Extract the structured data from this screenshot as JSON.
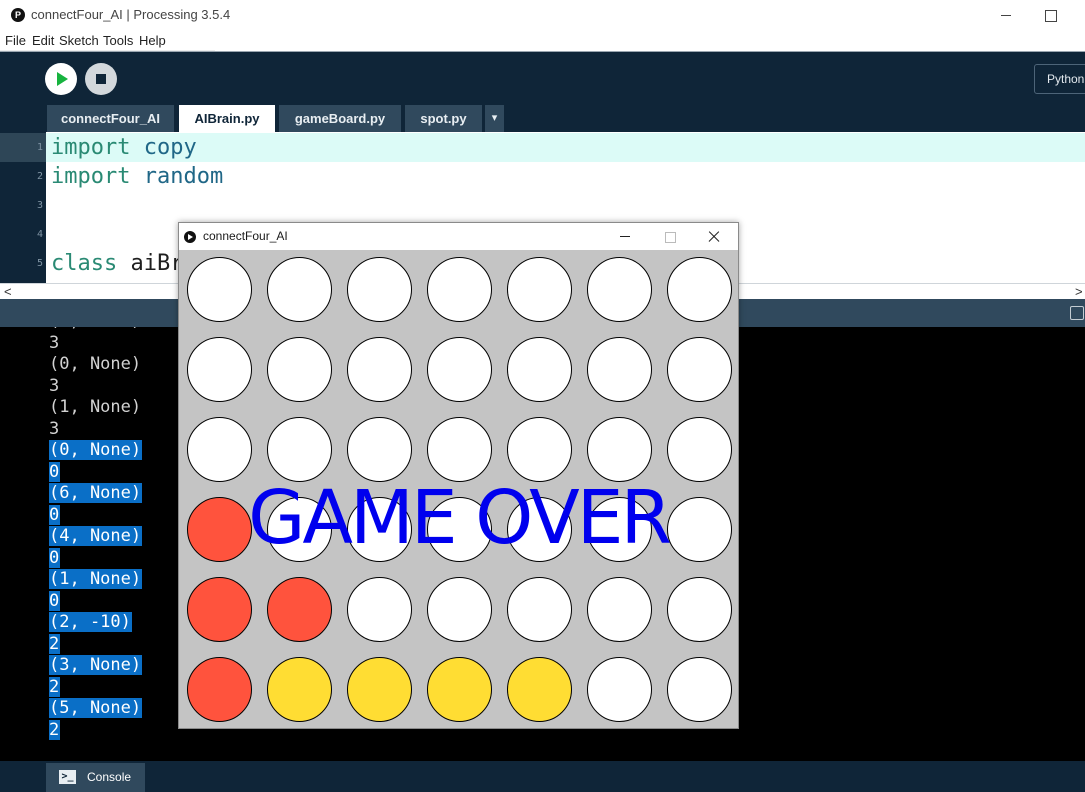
{
  "window": {
    "title": "connectFour_AI | Processing 3.5.4",
    "icon": "processing-logo-icon"
  },
  "menu": [
    "File",
    "Edit",
    "Sketch",
    "Tools",
    "Help"
  ],
  "toolbar": {
    "run_icon": "run-icon",
    "stop_icon": "stop-icon",
    "mode_label": "Python"
  },
  "tabs": [
    {
      "label": "connectFour_AI",
      "active": false
    },
    {
      "label": "AIBrain.py",
      "active": true
    },
    {
      "label": "gameBoard.py",
      "active": false
    },
    {
      "label": "spot.py",
      "active": false
    }
  ],
  "tab_menu_glyph": "▾",
  "editor": {
    "current_line": 1,
    "lines": [
      {
        "number": "1",
        "tokens": [
          {
            "text": "import",
            "kind": "kw"
          },
          {
            "text": " ",
            "kind": "plain"
          },
          {
            "text": "copy",
            "kind": "id"
          }
        ]
      },
      {
        "number": "2",
        "tokens": [
          {
            "text": "import",
            "kind": "kw"
          },
          {
            "text": " ",
            "kind": "plain"
          },
          {
            "text": "random",
            "kind": "id"
          }
        ]
      },
      {
        "number": "3",
        "tokens": []
      },
      {
        "number": "4",
        "tokens": []
      },
      {
        "number": "5",
        "tokens": [
          {
            "text": "class",
            "kind": "kw"
          },
          {
            "text": " ",
            "kind": "plain"
          },
          {
            "text": "aiBrain",
            "kind": "plain"
          }
        ]
      }
    ]
  },
  "scrollbar": {
    "left_arrow": "<",
    "right_arrow": ">"
  },
  "console": {
    "lines": [
      {
        "text": "(?, None)",
        "selected": false
      },
      {
        "text": "3",
        "selected": false
      },
      {
        "text": "(0, None)",
        "selected": false
      },
      {
        "text": "3",
        "selected": false
      },
      {
        "text": "(1, None)",
        "selected": false
      },
      {
        "text": "3",
        "selected": false
      },
      {
        "text": "(0, None)",
        "selected": true
      },
      {
        "text": "0",
        "selected": true
      },
      {
        "text": "(6, None)",
        "selected": true
      },
      {
        "text": "0",
        "selected": true
      },
      {
        "text": "(4, None)",
        "selected": true
      },
      {
        "text": "0",
        "selected": true
      },
      {
        "text": "(1, None)",
        "selected": true
      },
      {
        "text": "0",
        "selected": true
      },
      {
        "text": "(2, -10)",
        "selected": true
      },
      {
        "text": "2",
        "selected": true
      },
      {
        "text": "(3, None)",
        "selected": true
      },
      {
        "text": "2",
        "selected": true
      },
      {
        "text": "(5, None)",
        "selected": true
      },
      {
        "text": "2",
        "selected": true
      }
    ]
  },
  "bottom_tab": {
    "label": "Console",
    "icon": "terminal-icon",
    "icon_glyph": ">_"
  },
  "sketch": {
    "title": "connectFour_AI",
    "game_over_text": "GAME OVER",
    "colors": {
      "empty": "#ffffff",
      "red": "#ff533d",
      "yellow": "#ffdd33",
      "background": "#c4c4c4"
    },
    "board": [
      [
        "empty",
        "empty",
        "empty",
        "empty",
        "empty",
        "empty",
        "empty"
      ],
      [
        "empty",
        "empty",
        "empty",
        "empty",
        "empty",
        "empty",
        "empty"
      ],
      [
        "empty",
        "empty",
        "empty",
        "empty",
        "empty",
        "empty",
        "empty"
      ],
      [
        "red",
        "empty",
        "empty",
        "empty",
        "empty",
        "empty",
        "empty"
      ],
      [
        "red",
        "red",
        "empty",
        "empty",
        "empty",
        "empty",
        "empty"
      ],
      [
        "red",
        "yellow",
        "yellow",
        "yellow",
        "yellow",
        "empty",
        "empty"
      ]
    ]
  }
}
